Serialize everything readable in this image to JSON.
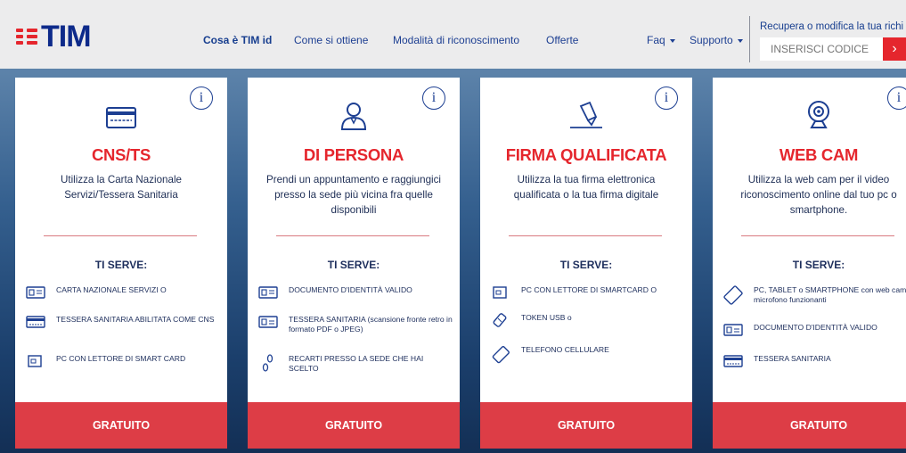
{
  "header": {
    "logo_text": "TIM",
    "nav": {
      "what": "Cosa è TIM id",
      "how": "Come si ottiene",
      "modes": "Modalità di riconoscimento",
      "offers": "Offerte",
      "faq": "Faq",
      "support": "Supporto"
    },
    "recover_text": "Recupera o modifica la tua richi",
    "code_placeholder": "INSERISCI CODICE",
    "code_button": "›"
  },
  "colors": {
    "brand_red": "#e5262d",
    "brand_blue": "#0d2a8a",
    "card_footer": "#dd3d46"
  },
  "cards": [
    {
      "icon": "card-reader-icon",
      "title": "CNS/TS",
      "desc": "Utilizza la Carta Nazionale Servizi/Tessera Sanitaria",
      "ts_label": "TI SERVE:",
      "reqs": [
        {
          "icon": "id-card-icon",
          "text": "CARTA NAZIONALE SERVIZI o"
        },
        {
          "icon": "health-card-icon",
          "text": "TESSERA SANITARIA ABILITATA COME CNS"
        },
        {
          "icon": "smart-card-reader-icon",
          "text": "PC CON LETTORE DI SMART CARD"
        }
      ],
      "foot": "GRATUITO"
    },
    {
      "icon": "person-icon",
      "title": "DI PERSONA",
      "desc": "Prendi un appuntamento e raggiungici presso la sede più vicina fra quelle disponibili",
      "ts_label": "TI SERVE:",
      "reqs": [
        {
          "icon": "id-document-icon",
          "text": "DOCUMENTO D'IDENTITÀ VALIDO"
        },
        {
          "icon": "health-card-icon",
          "text": "TESSERA SANITARIA (scansione fronte retro in formato PDF o JPEG)"
        },
        {
          "icon": "footsteps-icon",
          "text": "RECARTI PRESSO LA SEDE CHE HAI SCELTO"
        }
      ],
      "foot": "GRATUITO"
    },
    {
      "icon": "pen-signature-icon",
      "title": "FIRMA QUALIFICATA",
      "desc": "Utilizza la tua firma elettronica qualificata o la tua firma digitale",
      "ts_label": "TI SERVE:",
      "reqs": [
        {
          "icon": "smart-card-reader-icon",
          "text": "PC CON LETTORE DI SMARTCARD o"
        },
        {
          "icon": "usb-token-icon",
          "text": "TOKEN USB o"
        },
        {
          "icon": "mobile-phone-icon",
          "text": "TELEFONO CELLULARE"
        }
      ],
      "foot": "GRATUITO"
    },
    {
      "icon": "webcam-icon",
      "title": "WEB CAM",
      "desc": "Utilizza la web cam per il video riconoscimento online dal tuo pc o smartphone.",
      "ts_label": "TI SERVE:",
      "reqs": [
        {
          "icon": "tablet-icon",
          "text": "PC, TABLET o SMARTPHONE con web cam e microfono funzionanti"
        },
        {
          "icon": "id-document-icon",
          "text": "DOCUMENTO D'IDENTITÀ VALIDO"
        },
        {
          "icon": "health-card-icon",
          "text": "TESSERA SANITARIA"
        }
      ],
      "foot": "GRATUITO"
    }
  ]
}
